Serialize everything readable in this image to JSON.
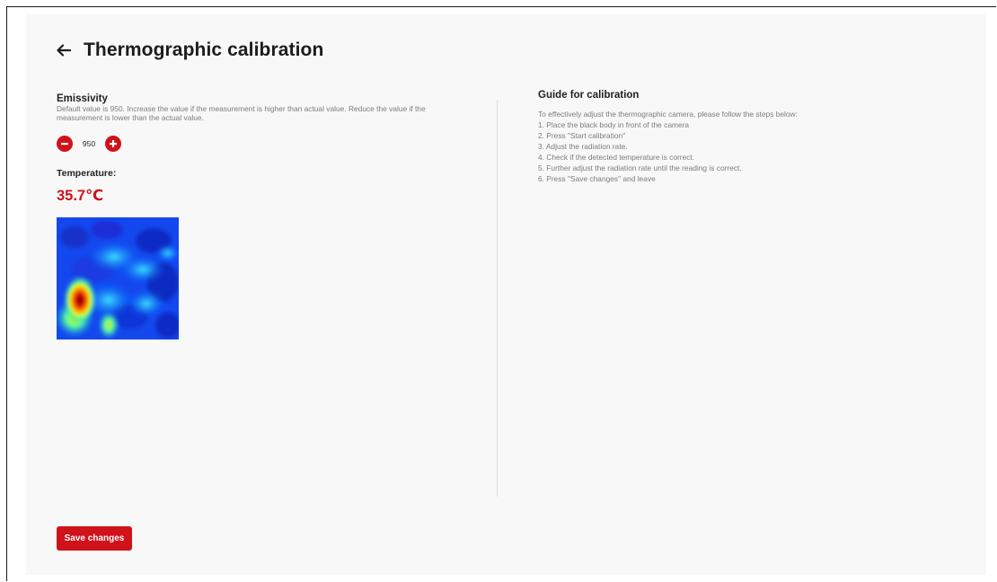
{
  "header": {
    "title": "Thermographic calibration",
    "back_icon": "arrow-left-icon"
  },
  "emissivity": {
    "title": "Emissivity",
    "description": "Default value is 950. Increase the value if the measurement is higher than actual value. Reduce the value if the measurement is lower than the actual value.",
    "value": "950",
    "decrement_icon": "minus-circle-icon",
    "increment_icon": "plus-circle-icon"
  },
  "temperature": {
    "label": "Temperature:",
    "value": "35.7℃"
  },
  "guide": {
    "title": "Guide for calibration",
    "intro": "To effectively adjust the thermographic camera, please follow the steps below:",
    "steps": [
      "1. Place the black body in front of the camera",
      "2. Press \"Start calibration\"",
      "3. Adjust the radiation rate.",
      "4. Check if the detected temperature is correct.",
      "5. Further adjust the radiation rate until the reading is correct.",
      "6. Press \"Save changes\" and leave"
    ]
  },
  "actions": {
    "save_label": "Save changes"
  },
  "colors": {
    "accent": "#d0121b",
    "panel": "#f8f8f8",
    "text": "#1f1f1f",
    "muted": "#7c7c7c"
  }
}
